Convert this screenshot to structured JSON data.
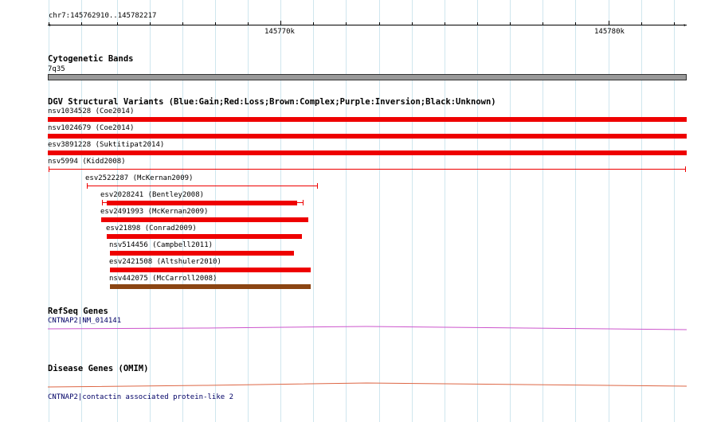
{
  "ruler": {
    "location": "chr7:145762910..145782217",
    "major_labels": [
      "145770k",
      "145780k"
    ]
  },
  "cytoband": {
    "title": "Cytogenetic Bands",
    "band": "7q35",
    "color": "#999999"
  },
  "dgv": {
    "title": "DGV Structural Variants (Blue:Gain;Red:Loss;Brown:Complex;Purple:Inversion;Black:Unknown)",
    "colors": {
      "loss": "#ee0000",
      "complex": "#8b4513"
    },
    "variants": [
      {
        "id": "nsv1034528 (Coe2014)",
        "type": "loss"
      },
      {
        "id": "nsv1024679 (Coe2014)",
        "type": "loss"
      },
      {
        "id": "esv3891228 (Suktitipat2014)",
        "type": "loss"
      },
      {
        "id": "nsv5994 (Kidd2008)",
        "type": "loss"
      },
      {
        "id": "esv2522287 (McKernan2009)",
        "type": "loss"
      },
      {
        "id": "esv2028241 (Bentley2008)",
        "type": "loss"
      },
      {
        "id": "esv2491993 (McKernan2009)",
        "type": "loss"
      },
      {
        "id": "esv21898 (Conrad2009)",
        "type": "loss"
      },
      {
        "id": "nsv514456 (Campbell2011)",
        "type": "loss"
      },
      {
        "id": "esv2421508 (Altshuler2010)",
        "type": "loss"
      },
      {
        "id": "nsv442075 (McCarroll2008)",
        "type": "complex"
      }
    ]
  },
  "refseq": {
    "title": "RefSeq Genes",
    "gene": "CNTNAP2|NM_014141",
    "color": "#cc55cc"
  },
  "disease": {
    "title": "Disease Genes (OMIM)",
    "gene": "CNTNAP2|contactin associated protein-like 2",
    "color": "#dd6644"
  }
}
